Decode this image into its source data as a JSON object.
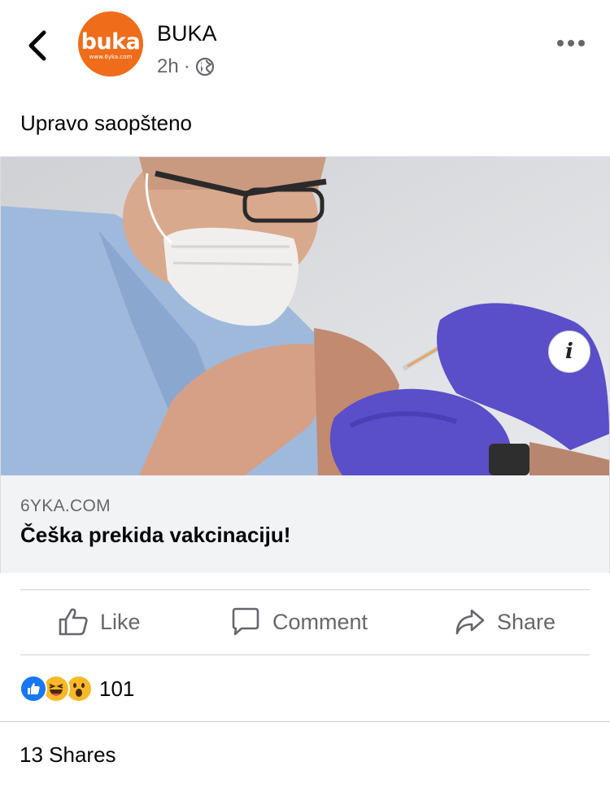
{
  "post": {
    "page_name": "BUKA",
    "time": "2h",
    "separator": "·",
    "avatar": {
      "brand": "buka",
      "site": "www.6yka.com",
      "color": "#ef6c1a"
    },
    "caption": "Upravo saopšteno"
  },
  "link": {
    "domain": "6YKA.COM",
    "title": "Češka prekida vakcinaciju!",
    "info_icon": "i"
  },
  "actions": {
    "like": "Like",
    "comment": "Comment",
    "share": "Share"
  },
  "reactions": {
    "types": [
      "like",
      "haha",
      "wow"
    ],
    "count": "101"
  },
  "shares": "13 Shares",
  "icons": {
    "back": "chevron-left-icon",
    "more": "more-horizontal-icon",
    "privacy": "globe-icon",
    "info": "info-icon"
  },
  "colors": {
    "accent": "#1877f2",
    "secondary_text": "#65676b",
    "divider": "#ced0d4"
  }
}
